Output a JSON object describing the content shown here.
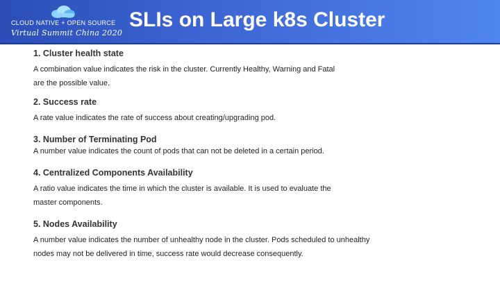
{
  "header": {
    "logo_line1": "CLOUD NATIVE + OPEN SOURCE",
    "logo_line2": "Virtual Summit China 2020",
    "title": "SLIs on Large k8s Cluster"
  },
  "colors": {
    "banner_start": "#2b4fb7",
    "banner_end": "#4f86ee"
  },
  "items": [
    {
      "heading": "1. Cluster health state",
      "lines": [
        "A combination value indicates the risk in the cluster. Currently Healthy, Warning and Fatal",
        "are the possible value."
      ]
    },
    {
      "heading": "2. Success rate",
      "lines": [
        "A rate value indicates the rate of success about creating/upgrading pod."
      ]
    },
    {
      "heading": "3. Number of Terminating Pod",
      "lines": [
        "A number value indicates the count of pods that can not be deleted in a certain period."
      ]
    },
    {
      "heading": "4. Centralized Components Availability",
      "lines": [
        "A ratio value indicates the time in which the cluster is available. It is used to evaluate the",
        "master components."
      ]
    },
    {
      "heading": "5. Nodes Availability",
      "lines": [
        "A number value indicates the number of unhealthy node in the cluster.  Pods scheduled to unhealthy",
        "nodes may not be delivered in time,  success rate would decrease consequently."
      ]
    }
  ]
}
